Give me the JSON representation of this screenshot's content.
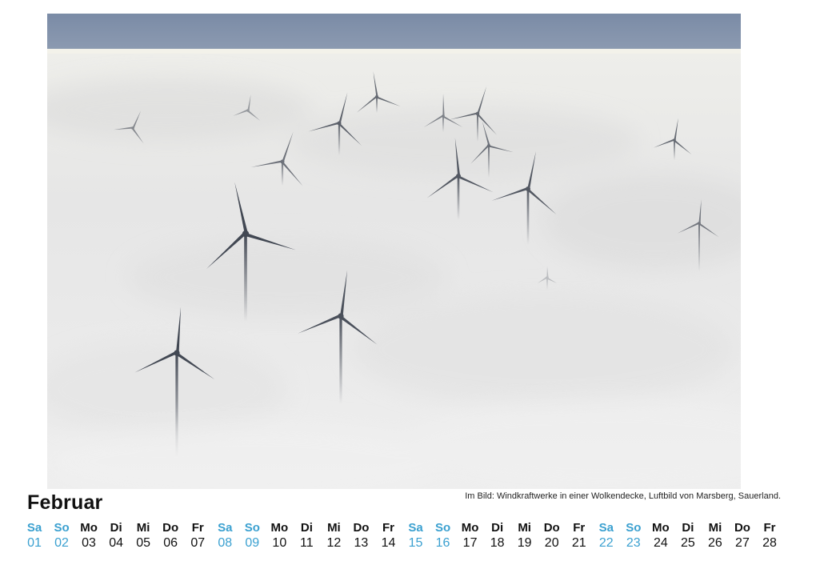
{
  "photo": {
    "subject": "wind-turbines-in-fog",
    "colors": {
      "sky": "#7c8ea8",
      "fog": "#ececec",
      "turbine": "#3a404c"
    }
  },
  "caption": "Im Bild: Windkraftwerke in einer Wolkendecke, Luftbild von Marsberg, Sauerland.",
  "month": "Februar",
  "weekend_color": "#3aa0d0",
  "days": [
    {
      "wd": "Sa",
      "num": "01",
      "weekend": true
    },
    {
      "wd": "So",
      "num": "02",
      "weekend": true
    },
    {
      "wd": "Mo",
      "num": "03",
      "weekend": false
    },
    {
      "wd": "Di",
      "num": "04",
      "weekend": false
    },
    {
      "wd": "Mi",
      "num": "05",
      "weekend": false
    },
    {
      "wd": "Do",
      "num": "06",
      "weekend": false
    },
    {
      "wd": "Fr",
      "num": "07",
      "weekend": false
    },
    {
      "wd": "Sa",
      "num": "08",
      "weekend": true
    },
    {
      "wd": "So",
      "num": "09",
      "weekend": true
    },
    {
      "wd": "Mo",
      "num": "10",
      "weekend": false
    },
    {
      "wd": "Di",
      "num": "11",
      "weekend": false
    },
    {
      "wd": "Mi",
      "num": "12",
      "weekend": false
    },
    {
      "wd": "Do",
      "num": "13",
      "weekend": false
    },
    {
      "wd": "Fr",
      "num": "14",
      "weekend": false
    },
    {
      "wd": "Sa",
      "num": "15",
      "weekend": true
    },
    {
      "wd": "So",
      "num": "16",
      "weekend": true
    },
    {
      "wd": "Mo",
      "num": "17",
      "weekend": false
    },
    {
      "wd": "Di",
      "num": "18",
      "weekend": false
    },
    {
      "wd": "Mi",
      "num": "19",
      "weekend": false
    },
    {
      "wd": "Do",
      "num": "20",
      "weekend": false
    },
    {
      "wd": "Fr",
      "num": "21",
      "weekend": false
    },
    {
      "wd": "Sa",
      "num": "22",
      "weekend": true
    },
    {
      "wd": "So",
      "num": "23",
      "weekend": true
    },
    {
      "wd": "Mo",
      "num": "24",
      "weekend": false
    },
    {
      "wd": "Di",
      "num": "25",
      "weekend": false
    },
    {
      "wd": "Mi",
      "num": "26",
      "weekend": false
    },
    {
      "wd": "Do",
      "num": "27",
      "weekend": false
    },
    {
      "wd": "Fr",
      "num": "28",
      "weekend": false
    }
  ]
}
